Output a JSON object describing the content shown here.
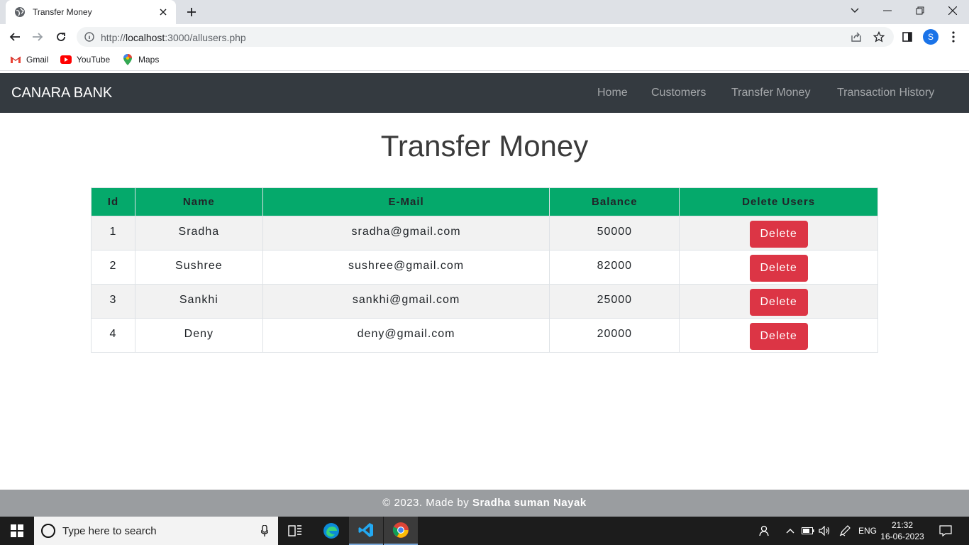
{
  "browser": {
    "tab_title": "Transfer Money",
    "url_host": "localhost",
    "url_prefix": "http://",
    "url_rest": ":3000/allusers.php",
    "profile_initial": "S",
    "bookmarks": [
      {
        "label": "Gmail",
        "icon": "gmail-icon"
      },
      {
        "label": "YouTube",
        "icon": "youtube-icon"
      },
      {
        "label": "Maps",
        "icon": "maps-icon"
      }
    ]
  },
  "site": {
    "brand": "CANARA BANK",
    "nav": [
      "Home",
      "Customers",
      "Transfer Money",
      "Transaction History"
    ],
    "heading": "Transfer Money",
    "table": {
      "headers": [
        "Id",
        "Name",
        "E-Mail",
        "Balance",
        "Delete Users"
      ],
      "rows": [
        {
          "id": "1",
          "name": "Sradha",
          "email": "sradha@gmail.com",
          "balance": "50000",
          "action": "Delete"
        },
        {
          "id": "2",
          "name": "Sushree",
          "email": "sushree@gmail.com",
          "balance": "82000",
          "action": "Delete"
        },
        {
          "id": "3",
          "name": "Sankhi",
          "email": "sankhi@gmail.com",
          "balance": "25000",
          "action": "Delete"
        },
        {
          "id": "4",
          "name": "Deny",
          "email": "deny@gmail.com",
          "balance": "20000",
          "action": "Delete"
        }
      ]
    },
    "footer_prefix": "© 2023. Made by",
    "footer_author": "Sradha suman Nayak"
  },
  "taskbar": {
    "search_placeholder": "Type here to search",
    "language": "ENG",
    "time": "21:32",
    "date": "16-06-2023"
  },
  "colors": {
    "navbar": "#343a40",
    "table_header": "#05a96b",
    "delete_button": "#dc3545",
    "footer": "#9a9da0"
  }
}
